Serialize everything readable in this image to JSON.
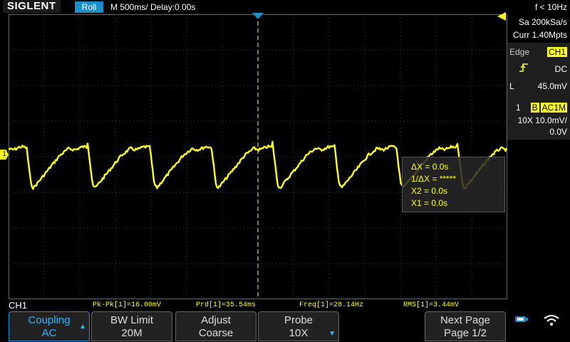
{
  "topbar": {
    "logo": "SIGLENT",
    "mode": "Roll",
    "timebase": "M 500ms/  Delay:0.00s",
    "frequency": "f < 10Hz"
  },
  "right_panel": {
    "sample_rate": "Sa 200kSa/s",
    "memory": "Curr 1.40Mpts",
    "trigger_type": "Edge",
    "trigger_source": "CH1",
    "trigger_coupling": "DC",
    "trigger_level_prefix": "L",
    "trigger_level": "45.0mV",
    "channel_number": "1",
    "channel_bw": "B",
    "channel_coupling": "AC1M",
    "probe_scale": "10X 10.0mV/",
    "offset": "0.0V"
  },
  "cursor_readout": {
    "delta_x": "ΔX = 0.0s",
    "inv_delta_x": "1/ΔX = *****",
    "x2": "X2 = 0.0s",
    "x1": "X1 = 0.0s"
  },
  "channel_marker": "1",
  "measurements": {
    "channel": "CH1",
    "pkpk": "Pk-Pk[1]=16.00mV",
    "prd": "Prd[1]=35.54ms",
    "freq": "Freq[1]=28.14Hz",
    "rms": "RMS[1]=3.44mV"
  },
  "softkeys": [
    {
      "line1": "Coupling",
      "line2": "AC"
    },
    {
      "line1": "BW Limit",
      "line2": "20M"
    },
    {
      "line1": "Adjust",
      "line2": "Coarse"
    },
    {
      "line1": "Probe",
      "line2": "10X"
    },
    {
      "line1": "Next Page",
      "line2": "Page 1/2"
    }
  ],
  "colors": {
    "trace": "#ffff22",
    "accent": "#1f8dc7",
    "grid": "#3a3a3a"
  },
  "icons": [
    "usb-icon",
    "wifi-icon",
    "trigger-position-icon",
    "trigger-level-icon",
    "rising-edge-icon"
  ]
}
